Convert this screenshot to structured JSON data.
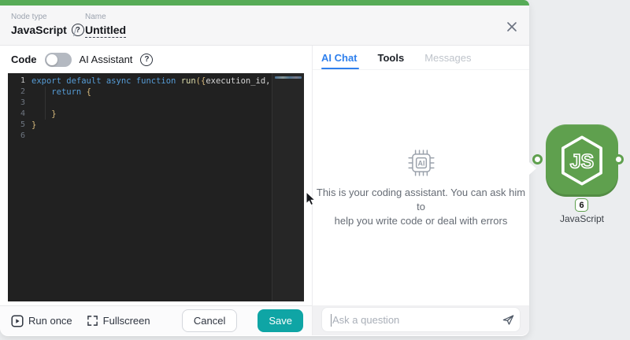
{
  "colors": {
    "topbar-green": "#57ab57",
    "accent-blue": "#2f80ed",
    "save-teal": "#0fa5a5",
    "node-green": "#5fa04e",
    "editor-bg": "#212121"
  },
  "header": {
    "node_type_label": "Node type",
    "node_type_value": "JavaScript",
    "separator": "/",
    "name_label": "Name",
    "name_value": "Untitled"
  },
  "left_panel": {
    "code_label": "Code",
    "ai_assistant_label": "AI Assistant",
    "editor": {
      "lines": [
        {
          "num": "1",
          "active": true,
          "segs": [
            [
              "kw",
              "export"
            ],
            [
              "pl",
              " "
            ],
            [
              "kw",
              "default"
            ],
            [
              "pl",
              " "
            ],
            [
              "kw",
              "async"
            ],
            [
              "pl",
              " "
            ],
            [
              "kw",
              "function"
            ],
            [
              "pl",
              " "
            ],
            [
              "fn",
              "run"
            ],
            [
              "br",
              "("
            ],
            [
              "br",
              "{"
            ],
            [
              "pl",
              "execution_id, input,"
            ]
          ]
        },
        {
          "num": "2",
          "segs": [
            [
              "pl",
              "    "
            ],
            [
              "kw",
              "return"
            ],
            [
              "pl",
              " "
            ],
            [
              "br",
              "{"
            ]
          ]
        },
        {
          "num": "3",
          "segs": []
        },
        {
          "num": "4",
          "segs": [
            [
              "pl",
              "    "
            ],
            [
              "br",
              "}"
            ]
          ]
        },
        {
          "num": "5",
          "segs": [
            [
              "br",
              "}"
            ]
          ]
        },
        {
          "num": "6",
          "segs": []
        }
      ]
    },
    "footer": {
      "run_once": "Run once",
      "fullscreen": "Fullscreen",
      "cancel": "Cancel",
      "save": "Save"
    }
  },
  "right_panel": {
    "tabs": [
      {
        "label": "AI Chat",
        "state": "active"
      },
      {
        "label": "Tools",
        "state": "normal"
      },
      {
        "label": "Messages",
        "state": "muted"
      }
    ],
    "ai_chip_text": "AI",
    "message_line1": "This is your coding assistant. You can ask him to",
    "message_line2": "help you write code or deal with errors",
    "input_placeholder": "Ask a question"
  },
  "canvas_node": {
    "logo_text": "JS",
    "badge": "6",
    "label": "JavaScript"
  }
}
